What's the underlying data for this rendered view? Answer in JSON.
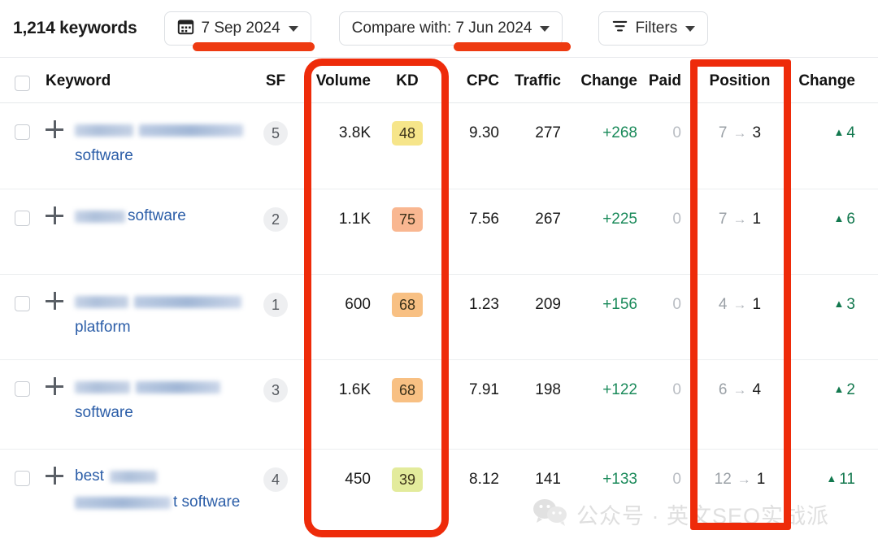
{
  "toolbar": {
    "keyword_count": "1,214 keywords",
    "date_button": {
      "label": "7 Sep 2024",
      "icon": "calendar-icon"
    },
    "compare_button": {
      "label": "Compare with: 7 Jun 2024"
    },
    "filters_button": {
      "label": "Filters",
      "icon": "filter-icon"
    }
  },
  "table": {
    "columns": [
      "Keyword",
      "SF",
      "Volume",
      "KD",
      "CPC",
      "Traffic",
      "Change",
      "Paid",
      "Position",
      "Change"
    ],
    "rows": [
      {
        "keyword_lines": [
          "",
          "software"
        ],
        "sf": "5",
        "volume": "3.8K",
        "kd": "48",
        "kd_color": "#f6e58a",
        "cpc": "9.30",
        "traffic": "277",
        "change": "+268",
        "paid": "0",
        "position_old": "7",
        "position_arrow": "→",
        "position_new": "3",
        "position_change": "4",
        "position_change_dir": "▲"
      },
      {
        "keyword_lines": [
          "software"
        ],
        "sf": "2",
        "volume": "1.1K",
        "kd": "75",
        "kd_color": "#f9b791",
        "cpc": "7.56",
        "traffic": "267",
        "change": "+225",
        "paid": "0",
        "position_old": "7",
        "position_arrow": "→",
        "position_new": "1",
        "position_change": "6",
        "position_change_dir": "▲"
      },
      {
        "keyword_lines": [
          "",
          "platform"
        ],
        "sf": "1",
        "volume": "600",
        "kd": "68",
        "kd_color": "#f8c083",
        "cpc": "1.23",
        "traffic": "209",
        "change": "+156",
        "paid": "0",
        "position_old": "4",
        "position_arrow": "→",
        "position_new": "1",
        "position_change": "3",
        "position_change_dir": "▲"
      },
      {
        "keyword_lines": [
          "",
          "software"
        ],
        "sf": "3",
        "volume": "1.6K",
        "kd": "68",
        "kd_color": "#f8c083",
        "cpc": "7.91",
        "traffic": "198",
        "change": "+122",
        "paid": "0",
        "position_old": "6",
        "position_arrow": "→",
        "position_new": "4",
        "position_change": "2",
        "position_change_dir": "▲"
      },
      {
        "keyword_lines": [
          "best",
          "t software"
        ],
        "sf": "4",
        "volume": "450",
        "kd": "39",
        "kd_color": "#e3eb9c",
        "cpc": "8.12",
        "traffic": "141",
        "change": "+133",
        "paid": "0",
        "position_old": "12",
        "position_arrow": "→",
        "position_new": "1",
        "position_change": "11",
        "position_change_dir": "▲"
      }
    ]
  },
  "annotations": {
    "color": "#ee2b0a",
    "volume_kd_highlight": "volume-kd-column-highlight",
    "position_highlight": "position-column-highlight",
    "date_underline": "date-button-underline",
    "compare_underline": "compare-button-underline"
  },
  "watermark": {
    "text": "公众号 · 英文SEO实战派",
    "icon": "wechat-icon"
  }
}
